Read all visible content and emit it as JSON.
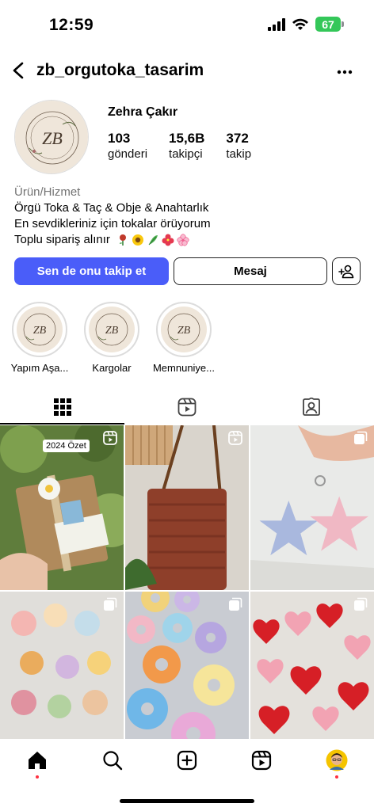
{
  "status_bar": {
    "time": "12:59",
    "battery": "67"
  },
  "header": {
    "username": "zb_orgutoka_tasarim"
  },
  "profile": {
    "display_name": "Zehra Çakır",
    "avatar_logo_text": "ZB ÖRGÜ TOKA & TAÇ",
    "stats": [
      {
        "value": "103",
        "label": "gönderi"
      },
      {
        "value": "15,6B",
        "label": "takipçi"
      },
      {
        "value": "372",
        "label": "takip"
      }
    ],
    "category": "Ürün/Hizmet",
    "bio_lines": [
      "Örgü Toka & Taç & Obje & Anahtarlık",
      "En sevdikleriniz için tokalar örüyorum",
      "Toplu sipariş alınır"
    ],
    "bio_emojis": [
      "rose-emoji",
      "sunflower-emoji",
      "herb-emoji",
      "hibiscus-emoji",
      "cherry-blossom-emoji"
    ]
  },
  "actions": {
    "follow_label": "Sen de onu takip et",
    "message_label": "Mesaj"
  },
  "highlights": [
    {
      "label": "Yapım Aşa..."
    },
    {
      "label": "Kargolar"
    },
    {
      "label": "Memnuniye..."
    }
  ],
  "tabs": [
    "grid-icon",
    "reels-icon",
    "tagged-icon"
  ],
  "posts": [
    {
      "tag": "2024 Özet",
      "badge": "reel-icon"
    },
    {
      "badge": "reel-icon"
    },
    {
      "badge": "carousel-icon"
    },
    {
      "badge": "carousel-icon"
    },
    {
      "badge": "carousel-icon"
    },
    {
      "badge": "carousel-icon"
    }
  ],
  "bottom_nav": [
    "home-icon",
    "search-icon",
    "create-icon",
    "reels-icon",
    "profile-avatar"
  ],
  "colors": {
    "accent": "#4a5df9",
    "notification": "#ff3040",
    "battery": "#34c759"
  }
}
